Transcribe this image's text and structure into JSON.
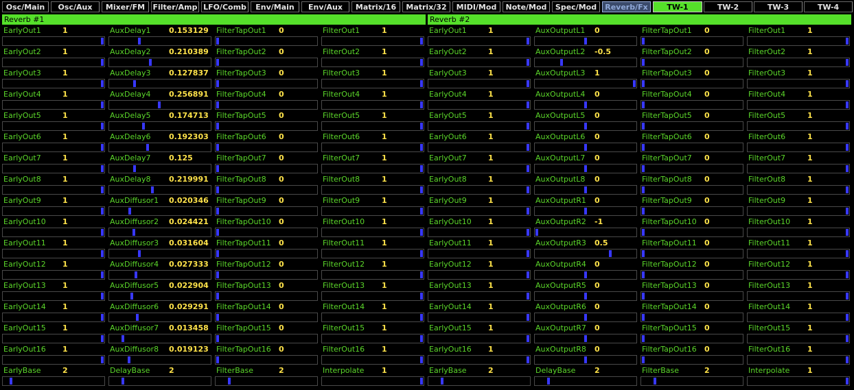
{
  "colors": {
    "accent": "#55e02a",
    "label": "#5bd62a",
    "value": "#ffe34a",
    "knob": "#3838ff",
    "active_tab": "#3a4a6a"
  },
  "tabs": [
    "Osc/Main",
    "Osc/Aux",
    "Mixer/FM",
    "Filter/Amp",
    "LFO/Comb",
    "Env/Main",
    "Env/Aux",
    "Matrix/16",
    "Matrix/32",
    "MIDI/Mod",
    "Note/Mod",
    "Spec/Mod",
    "Reverb/Fx",
    "TW-1",
    "TW-2",
    "TW-3",
    "TW-4"
  ],
  "active_tab": "Reverb/Fx",
  "selected_tw": "TW-1",
  "panels": [
    {
      "title": "Reverb #1",
      "columns": [
        [
          {
            "label": "EarlyOut1",
            "value": "1",
            "level": 1
          },
          {
            "label": "EarlyOut2",
            "value": "1",
            "level": 1
          },
          {
            "label": "EarlyOut3",
            "value": "1",
            "level": 1
          },
          {
            "label": "EarlyOut4",
            "value": "1",
            "level": 1
          },
          {
            "label": "EarlyOut5",
            "value": "1",
            "level": 1
          },
          {
            "label": "EarlyOut6",
            "value": "1",
            "level": 1
          },
          {
            "label": "EarlyOut7",
            "value": "1",
            "level": 1
          },
          {
            "label": "EarlyOut8",
            "value": "1",
            "level": 1
          },
          {
            "label": "EarlyOut9",
            "value": "1",
            "level": 1
          },
          {
            "label": "EarlyOut10",
            "value": "1",
            "level": 1
          },
          {
            "label": "EarlyOut11",
            "value": "1",
            "level": 1
          },
          {
            "label": "EarlyOut12",
            "value": "1",
            "level": 1
          },
          {
            "label": "EarlyOut13",
            "value": "1",
            "level": 1
          },
          {
            "label": "EarlyOut14",
            "value": "1",
            "level": 1
          },
          {
            "label": "EarlyOut15",
            "value": "1",
            "level": 1
          },
          {
            "label": "EarlyOut16",
            "value": "1",
            "level": 1
          },
          {
            "label": "EarlyBase",
            "value": "2",
            "level": 0.06
          }
        ],
        [
          {
            "label": "AuxDelay1",
            "value": "0.153129",
            "level": 0.29
          },
          {
            "label": "AuxDelay2",
            "value": "0.210389",
            "level": 0.4
          },
          {
            "label": "AuxDelay3",
            "value": "0.127837",
            "level": 0.24
          },
          {
            "label": "AuxDelay4",
            "value": "0.256891",
            "level": 0.49
          },
          {
            "label": "AuxDelay5",
            "value": "0.174713",
            "level": 0.33
          },
          {
            "label": "AuxDelay6",
            "value": "0.192303",
            "level": 0.37
          },
          {
            "label": "AuxDelay7",
            "value": "0.125",
            "level": 0.24
          },
          {
            "label": "AuxDelay8",
            "value": "0.219991",
            "level": 0.42
          },
          {
            "label": "AuxDiffusor1",
            "value": "0.020346",
            "level": 0.19
          },
          {
            "label": "AuxDiffusor2",
            "value": "0.024421",
            "level": 0.23
          },
          {
            "label": "AuxDiffusor3",
            "value": "0.031604",
            "level": 0.29
          },
          {
            "label": "AuxDiffusor4",
            "value": "0.027333",
            "level": 0.25
          },
          {
            "label": "AuxDiffusor5",
            "value": "0.022904",
            "level": 0.21
          },
          {
            "label": "AuxDiffusor6",
            "value": "0.029291",
            "level": 0.27
          },
          {
            "label": "AuxDiffusor7",
            "value": "0.013458",
            "level": 0.12
          },
          {
            "label": "AuxDiffusor8",
            "value": "0.019123",
            "level": 0.18
          },
          {
            "label": "DelayBase",
            "value": "2",
            "level": 0.12
          }
        ],
        [
          {
            "label": "FilterTapOut1",
            "value": "0",
            "level": 0
          },
          {
            "label": "FilterTapOut2",
            "value": "0",
            "level": 0
          },
          {
            "label": "FilterTapOut3",
            "value": "0",
            "level": 0
          },
          {
            "label": "FilterTapOut4",
            "value": "0",
            "level": 0
          },
          {
            "label": "FilterTapOut5",
            "value": "0",
            "level": 0
          },
          {
            "label": "FilterTapOut6",
            "value": "0",
            "level": 0
          },
          {
            "label": "FilterTapOut7",
            "value": "0",
            "level": 0
          },
          {
            "label": "FilterTapOut8",
            "value": "0",
            "level": 0
          },
          {
            "label": "FilterTapOut9",
            "value": "0",
            "level": 0
          },
          {
            "label": "FilterTapOut10",
            "value": "0",
            "level": 0
          },
          {
            "label": "FilterTapOut11",
            "value": "0",
            "level": 0
          },
          {
            "label": "FilterTapOut12",
            "value": "0",
            "level": 0
          },
          {
            "label": "FilterTapOut13",
            "value": "0",
            "level": 0
          },
          {
            "label": "FilterTapOut14",
            "value": "0",
            "level": 0
          },
          {
            "label": "FilterTapOut15",
            "value": "0",
            "level": 0
          },
          {
            "label": "FilterTapOut16",
            "value": "0",
            "level": 0
          },
          {
            "label": "FilterBase",
            "value": "2",
            "level": 0.12
          }
        ],
        [
          {
            "label": "FilterOut1",
            "value": "1",
            "level": 1
          },
          {
            "label": "FilterOut2",
            "value": "1",
            "level": 1
          },
          {
            "label": "FilterOut3",
            "value": "1",
            "level": 1
          },
          {
            "label": "FilterOut4",
            "value": "1",
            "level": 1
          },
          {
            "label": "FilterOut5",
            "value": "1",
            "level": 1
          },
          {
            "label": "FilterOut6",
            "value": "1",
            "level": 1
          },
          {
            "label": "FilterOut7",
            "value": "1",
            "level": 1
          },
          {
            "label": "FilterOut8",
            "value": "1",
            "level": 1
          },
          {
            "label": "FilterOut9",
            "value": "1",
            "level": 1
          },
          {
            "label": "FilterOut10",
            "value": "1",
            "level": 1
          },
          {
            "label": "FilterOut11",
            "value": "1",
            "level": 1
          },
          {
            "label": "FilterOut12",
            "value": "1",
            "level": 1
          },
          {
            "label": "FilterOut13",
            "value": "1",
            "level": 1
          },
          {
            "label": "FilterOut14",
            "value": "1",
            "level": 1
          },
          {
            "label": "FilterOut15",
            "value": "1",
            "level": 1
          },
          {
            "label": "FilterOut16",
            "value": "1",
            "level": 1
          },
          {
            "label": "Interpolate",
            "value": "1",
            "level": 1
          }
        ]
      ]
    },
    {
      "title": "Reverb #2",
      "columns": [
        [
          {
            "label": "EarlyOut1",
            "value": "1",
            "level": 1
          },
          {
            "label": "EarlyOut2",
            "value": "1",
            "level": 1
          },
          {
            "label": "EarlyOut3",
            "value": "1",
            "level": 1
          },
          {
            "label": "EarlyOut4",
            "value": "1",
            "level": 1
          },
          {
            "label": "EarlyOut5",
            "value": "1",
            "level": 1
          },
          {
            "label": "EarlyOut6",
            "value": "1",
            "level": 1
          },
          {
            "label": "EarlyOut7",
            "value": "1",
            "level": 1
          },
          {
            "label": "EarlyOut8",
            "value": "1",
            "level": 1
          },
          {
            "label": "EarlyOut9",
            "value": "1",
            "level": 1
          },
          {
            "label": "EarlyOut10",
            "value": "1",
            "level": 1
          },
          {
            "label": "EarlyOut11",
            "value": "1",
            "level": 1
          },
          {
            "label": "EarlyOut12",
            "value": "1",
            "level": 1
          },
          {
            "label": "EarlyOut13",
            "value": "1",
            "level": 1
          },
          {
            "label": "EarlyOut14",
            "value": "1",
            "level": 1
          },
          {
            "label": "EarlyOut15",
            "value": "1",
            "level": 1
          },
          {
            "label": "EarlyOut16",
            "value": "1",
            "level": 1
          },
          {
            "label": "EarlyBase",
            "value": "2",
            "level": 0.12
          }
        ],
        [
          {
            "label": "AuxOutputL1",
            "value": "0",
            "level": 0.5
          },
          {
            "label": "AuxOutputL2",
            "value": "-0.5",
            "level": 0.25
          },
          {
            "label": "AuxOutputL3",
            "value": "1",
            "level": 1
          },
          {
            "label": "AuxOutputL4",
            "value": "0",
            "level": 0.5
          },
          {
            "label": "AuxOutputL5",
            "value": "0",
            "level": 0.5
          },
          {
            "label": "AuxOutputL6",
            "value": "0",
            "level": 0.5
          },
          {
            "label": "AuxOutputL7",
            "value": "0",
            "level": 0.5
          },
          {
            "label": "AuxOutputL8",
            "value": "0",
            "level": 0.5
          },
          {
            "label": "AuxOutputR1",
            "value": "0",
            "level": 0.5
          },
          {
            "label": "AuxOutputR2",
            "value": "-1",
            "level": 0
          },
          {
            "label": "AuxOutputR3",
            "value": "0.5",
            "level": 0.75
          },
          {
            "label": "AuxOutputR4",
            "value": "0",
            "level": 0.5
          },
          {
            "label": "AuxOutputR5",
            "value": "0",
            "level": 0.5
          },
          {
            "label": "AuxOutputR6",
            "value": "0",
            "level": 0.5
          },
          {
            "label": "AuxOutputR7",
            "value": "0",
            "level": 0.5
          },
          {
            "label": "AuxOutputR8",
            "value": "0",
            "level": 0.5
          },
          {
            "label": "DelayBase",
            "value": "2",
            "level": 0.12
          }
        ],
        [
          {
            "label": "FilterTapOut1",
            "value": "0",
            "level": 0
          },
          {
            "label": "FilterTapOut2",
            "value": "0",
            "level": 0
          },
          {
            "label": "FilterTapOut3",
            "value": "0",
            "level": 0
          },
          {
            "label": "FilterTapOut4",
            "value": "0",
            "level": 0
          },
          {
            "label": "FilterTapOut5",
            "value": "0",
            "level": 0
          },
          {
            "label": "FilterTapOut6",
            "value": "0",
            "level": 0
          },
          {
            "label": "FilterTapOut7",
            "value": "0",
            "level": 0
          },
          {
            "label": "FilterTapOut8",
            "value": "0",
            "level": 0
          },
          {
            "label": "FilterTapOut9",
            "value": "0",
            "level": 0
          },
          {
            "label": "FilterTapOut10",
            "value": "0",
            "level": 0
          },
          {
            "label": "FilterTapOut11",
            "value": "0",
            "level": 0
          },
          {
            "label": "FilterTapOut12",
            "value": "0",
            "level": 0
          },
          {
            "label": "FilterTapOut13",
            "value": "0",
            "level": 0
          },
          {
            "label": "FilterTapOut14",
            "value": "0",
            "level": 0
          },
          {
            "label": "FilterTapOut15",
            "value": "0",
            "level": 0
          },
          {
            "label": "FilterTapOut16",
            "value": "0",
            "level": 0
          },
          {
            "label": "FilterBase",
            "value": "2",
            "level": 0.12
          }
        ],
        [
          {
            "label": "FilterOut1",
            "value": "1",
            "level": 1
          },
          {
            "label": "FilterOut2",
            "value": "1",
            "level": 1
          },
          {
            "label": "FilterOut3",
            "value": "1",
            "level": 1
          },
          {
            "label": "FilterOut4",
            "value": "1",
            "level": 1
          },
          {
            "label": "FilterOut5",
            "value": "1",
            "level": 1
          },
          {
            "label": "FilterOut6",
            "value": "1",
            "level": 1
          },
          {
            "label": "FilterOut7",
            "value": "1",
            "level": 1
          },
          {
            "label": "FilterOut8",
            "value": "1",
            "level": 1
          },
          {
            "label": "FilterOut9",
            "value": "1",
            "level": 1
          },
          {
            "label": "FilterOut10",
            "value": "1",
            "level": 1
          },
          {
            "label": "FilterOut11",
            "value": "1",
            "level": 1
          },
          {
            "label": "FilterOut12",
            "value": "1",
            "level": 1
          },
          {
            "label": "FilterOut13",
            "value": "1",
            "level": 1
          },
          {
            "label": "FilterOut14",
            "value": "1",
            "level": 1
          },
          {
            "label": "FilterOut15",
            "value": "1",
            "level": 1
          },
          {
            "label": "FilterOut16",
            "value": "1",
            "level": 1
          },
          {
            "label": "Interpolate",
            "value": "1",
            "level": 1
          }
        ]
      ]
    }
  ]
}
